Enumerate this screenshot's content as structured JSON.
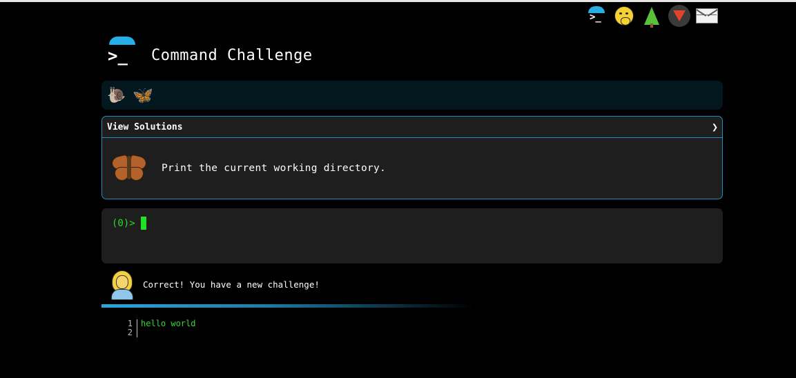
{
  "header": {
    "title": "Command Challenge"
  },
  "top_icons": [
    "cmdchallenge-logo-icon",
    "hand-over-mouth-emoji-icon",
    "evergreen-tree-icon",
    "gitlab-icon",
    "mail-icon"
  ],
  "progress": {
    "icons": [
      "snail-icon",
      "butterfly-icon"
    ]
  },
  "challenge": {
    "view_solutions_label": "View Solutions",
    "expand_glyph": "❯",
    "task": "Print the current working directory."
  },
  "terminal": {
    "prompt": "(0)>"
  },
  "message": {
    "text": "Correct! You have a new challenge!"
  },
  "output": {
    "line_numbers": [
      "1",
      "2"
    ],
    "lines": [
      "hello world",
      ""
    ]
  }
}
